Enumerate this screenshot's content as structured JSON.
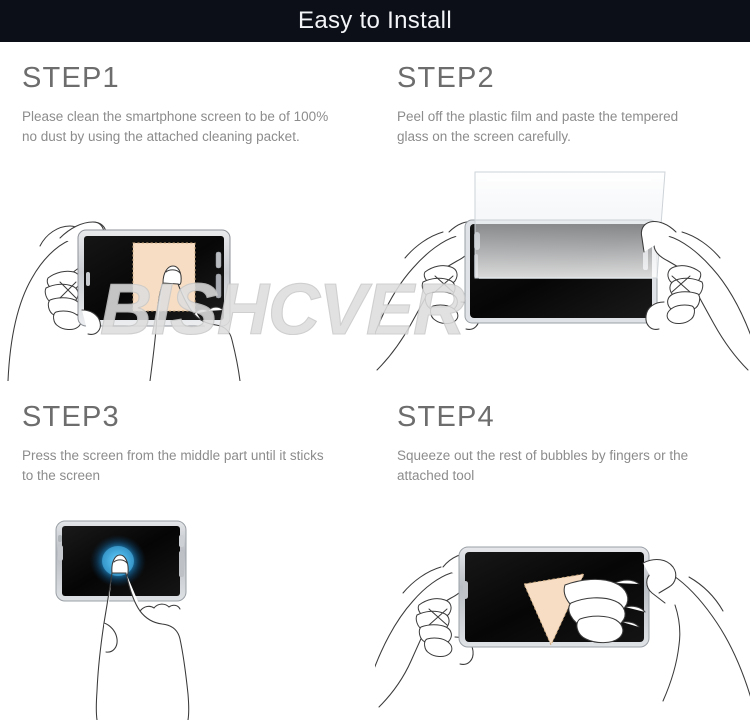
{
  "header": {
    "title": "Easy to Install",
    "background_color": "#0c0f17",
    "text_color": "#f2f4f8"
  },
  "watermark": {
    "text": "BISHCVER",
    "color": "#dedede"
  },
  "page": {
    "background_color": "#ffffff",
    "heading_color": "#6d6d6d",
    "body_color": "#8c8c8c",
    "cloth_color": "#f7ddc3",
    "touch_glow_color": "#1f8fd0",
    "phone_screen_color": "#0a0a0a"
  },
  "steps": [
    {
      "heading": "STEP1",
      "body": "Please clean the smartphone screen to be of 100% no dust by using the attached cleaning packet.",
      "illustration": "hand-holding-phone-wiping-with-cleaning-cloth"
    },
    {
      "heading": "STEP2",
      "body": "Peel off the plastic film and paste the tempered glass on the screen carefully.",
      "illustration": "two-hands-applying-tempered-glass-to-phone"
    },
    {
      "heading": "STEP3",
      "body": "Press the screen from the middle part until it sticks to the screen",
      "illustration": "finger-pressing-center-of-phone-screen-with-glow"
    },
    {
      "heading": "STEP4",
      "body": "Squeeze out the rest of bubbles by fingers or the attached tool",
      "illustration": "two-hands-squeezing-bubbles-with-cloth-tool"
    }
  ]
}
